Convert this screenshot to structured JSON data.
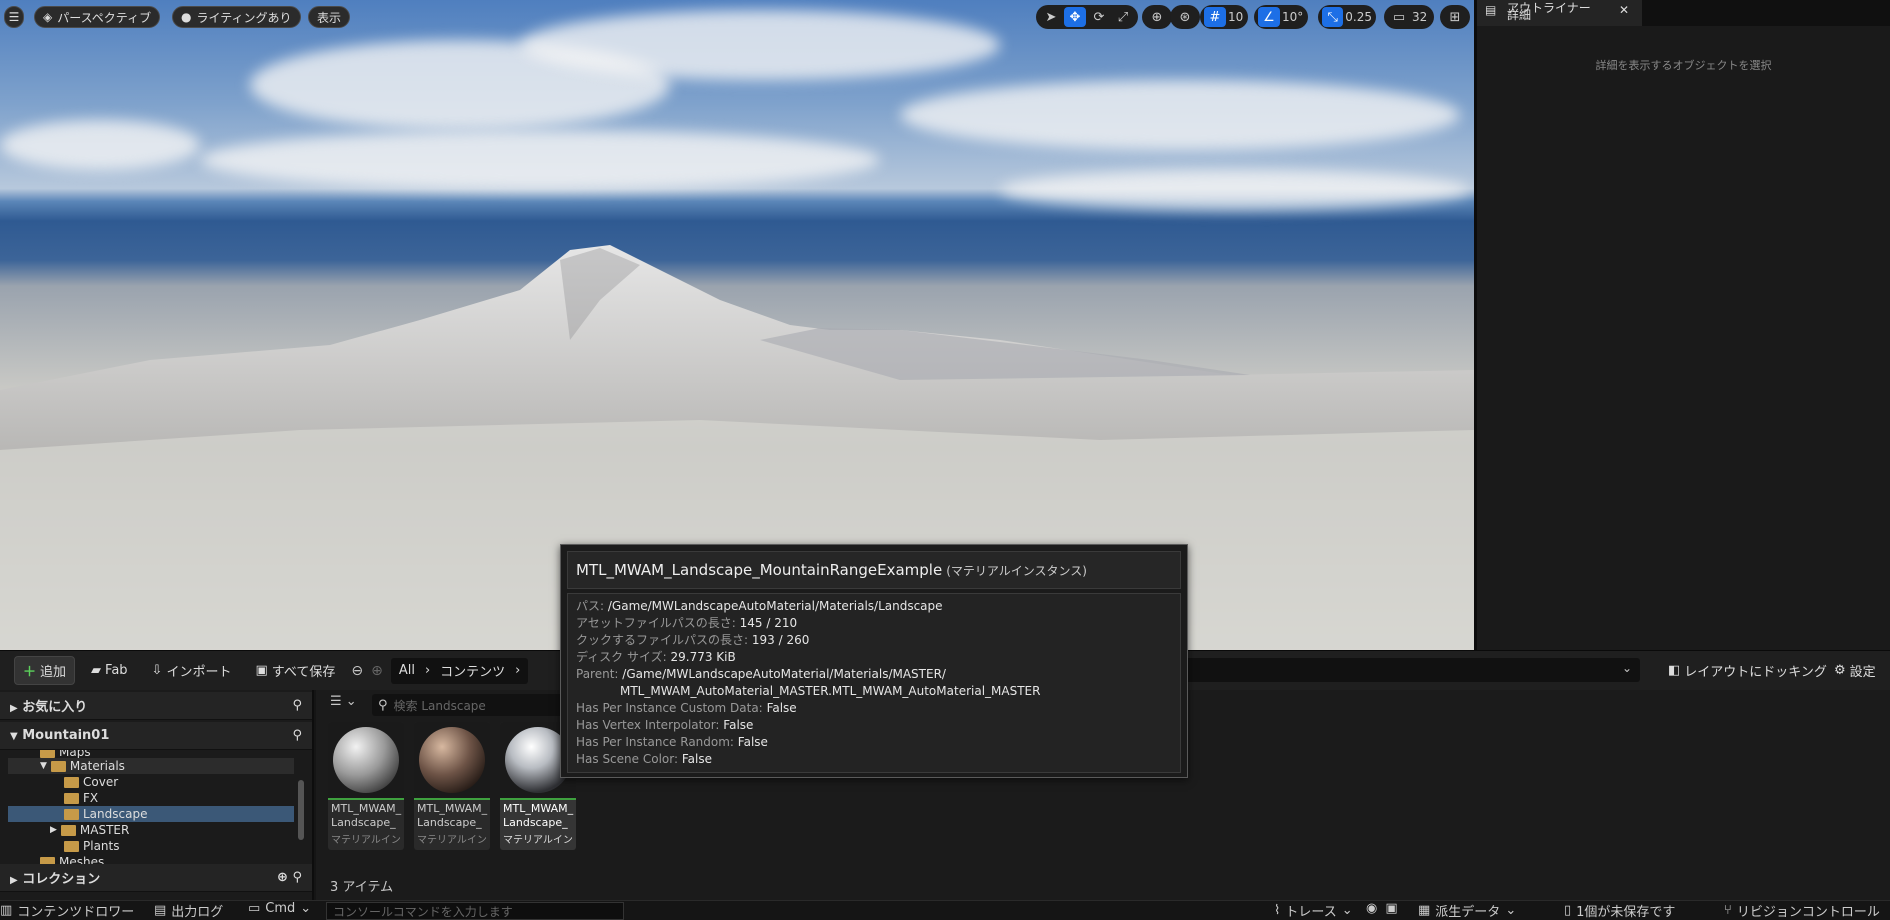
{
  "viewport": {
    "perspective_label": "パースペクティブ",
    "lighting_label": "ライティングあり",
    "show_label": "表示",
    "grid_value": "10",
    "angle_value": "10°",
    "scale_value": "0.25",
    "camera_speed": "32"
  },
  "details": {
    "tab_outliner": "アウトライナー",
    "tab_details": "詳細",
    "empty_message": "詳細を表示するオブジェクトを選択"
  },
  "content_toolbar": {
    "add_label": "追加",
    "fab_label": "Fab",
    "import_label": "インポート",
    "save_all_label": "すべて保存",
    "breadcrumb": [
      "All",
      "コンテンツ"
    ],
    "dock_label": "レイアウトにドッキング",
    "settings_label": "設定"
  },
  "left_panel": {
    "favorites_label": "お気に入り",
    "project_label": "Mountain01",
    "collections_label": "コレクション",
    "tree": [
      {
        "label": "Maps",
        "depth": 1
      },
      {
        "label": "Materials",
        "depth": 1
      },
      {
        "label": "Cover",
        "depth": 2
      },
      {
        "label": "FX",
        "depth": 2
      },
      {
        "label": "Landscape",
        "depth": 2
      },
      {
        "label": "MASTER",
        "depth": 2
      },
      {
        "label": "Plants",
        "depth": 2
      },
      {
        "label": "Meshes",
        "depth": 1
      }
    ]
  },
  "assets": {
    "filter_icon": "filter-icon",
    "search_placeholder": "検索 Landscape",
    "count_label": "3 アイテム",
    "items": [
      {
        "name1": "MTL_MWAM_",
        "name2": "Landscape_",
        "type": "マテリアルインス..."
      },
      {
        "name1": "MTL_MWAM_",
        "name2": "Landscape_",
        "type": "マテリアルインス..."
      },
      {
        "name1": "MTL_MWAM_",
        "name2": "Landscape_",
        "type": "マテリアルインス..."
      }
    ]
  },
  "tooltip": {
    "title": "MTL_MWAM_Landscape_MountainRangeExample",
    "title_type": "(マテリアルインスタンス)",
    "path_label": "パス:",
    "path_value": "/Game/MWLandscapeAutoMaterial/Materials/Landscape",
    "asset_len_label": "アセットファイルパスの長さ:",
    "asset_len_value": "145 / 210",
    "cook_len_label": "クックするファイルパスの長さ:",
    "cook_len_value": "193 / 260",
    "disk_label": "ディスク サイズ:",
    "disk_value": "29.773 KiB",
    "parent_label": "Parent:",
    "parent_value1": "/Game/MWLandscapeAutoMaterial/Materials/MASTER/",
    "parent_value2": "MTL_MWAM_AutoMaterial_MASTER.MTL_MWAM_AutoMaterial_MASTER",
    "custom_data_label": "Has Per Instance Custom Data:",
    "custom_data_value": "False",
    "vertex_label": "Has Vertex Interpolator:",
    "vertex_value": "False",
    "random_label": "Has Per Instance Random:",
    "random_value": "False",
    "scene_color_label": "Has Scene Color:",
    "scene_color_value": "False"
  },
  "statusbar": {
    "content_drawer": "コンテンツドロワー",
    "output_log": "出力ログ",
    "cmd_label": "Cmd",
    "console_placeholder": "コンソールコマンドを入力します",
    "trace_label": "トレース",
    "derived_data_label": "派生データ",
    "unsaved_label": "1個が未保存です",
    "revision_label": "リビジョンコントロール"
  }
}
